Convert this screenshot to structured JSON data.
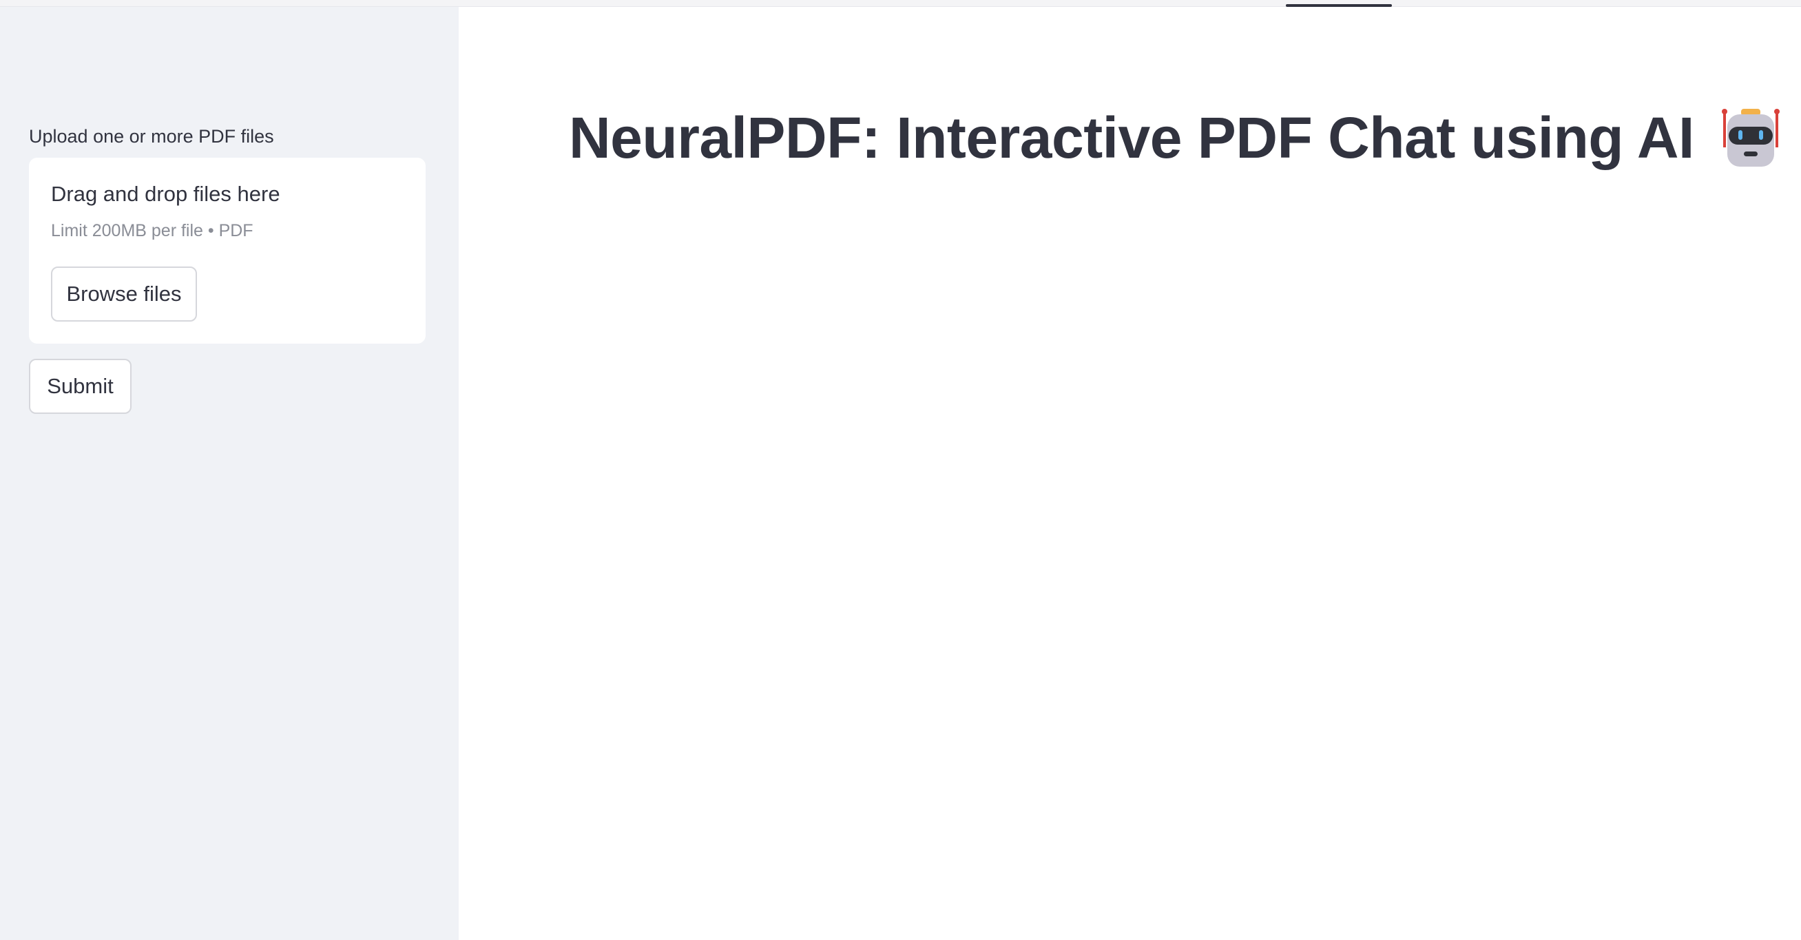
{
  "sidebar": {
    "upload_label": "Upload one or more PDF files",
    "dropzone": {
      "title": "Drag and drop files here",
      "limit": "Limit 200MB per file • PDF",
      "browse_label": "Browse files"
    },
    "submit_label": "Submit"
  },
  "main": {
    "title": "NeuralPDF: Interactive PDF Chat using AI",
    "title_icon": "robot-icon"
  },
  "colors": {
    "sidebar_bg": "#f0f2f6",
    "text": "#31333f",
    "muted_text": "#8a8d96",
    "border": "#d6d7dc"
  }
}
